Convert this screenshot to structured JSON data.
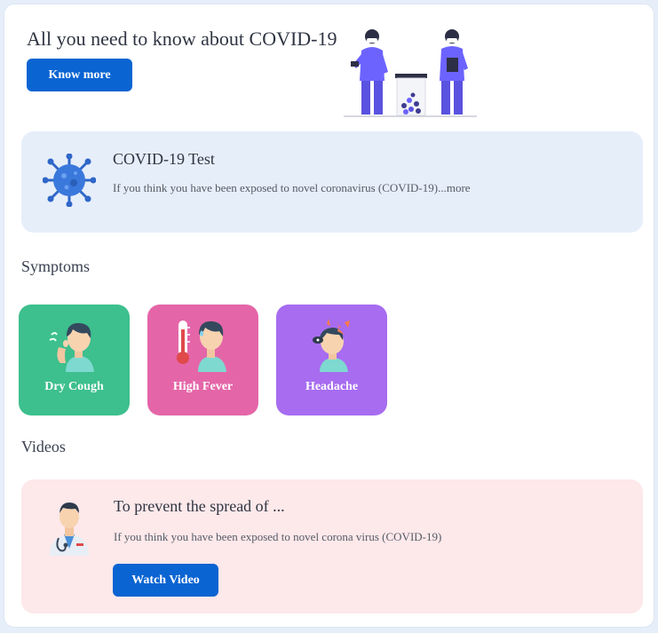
{
  "hero": {
    "title": "All you need to know about COVID-19",
    "button_label": "Know more"
  },
  "test_card": {
    "title": "COVID-19 Test",
    "description": "If you think you have been exposed to novel coronavirus (COVID-19)...more",
    "icon": "virus-icon"
  },
  "symptoms": {
    "heading": "Symptoms",
    "items": [
      {
        "label": "Dry Cough",
        "color": "#3dbf8e",
        "icon": "cough-icon"
      },
      {
        "label": "High Fever",
        "color": "#e466a8",
        "icon": "thermometer-icon"
      },
      {
        "label": "Headache",
        "color": "#a76cf0",
        "icon": "headache-icon"
      }
    ]
  },
  "videos": {
    "heading": "Videos",
    "title": "To prevent the spread of ...",
    "description": "If you think you have been exposed to novel corona virus (COVID-19)",
    "button_label": "Watch Video",
    "icon": "doctor-icon"
  },
  "colors": {
    "primary": "#0a64d2",
    "test_card_bg": "#e6eefa",
    "video_card_bg": "#fde8ea"
  }
}
